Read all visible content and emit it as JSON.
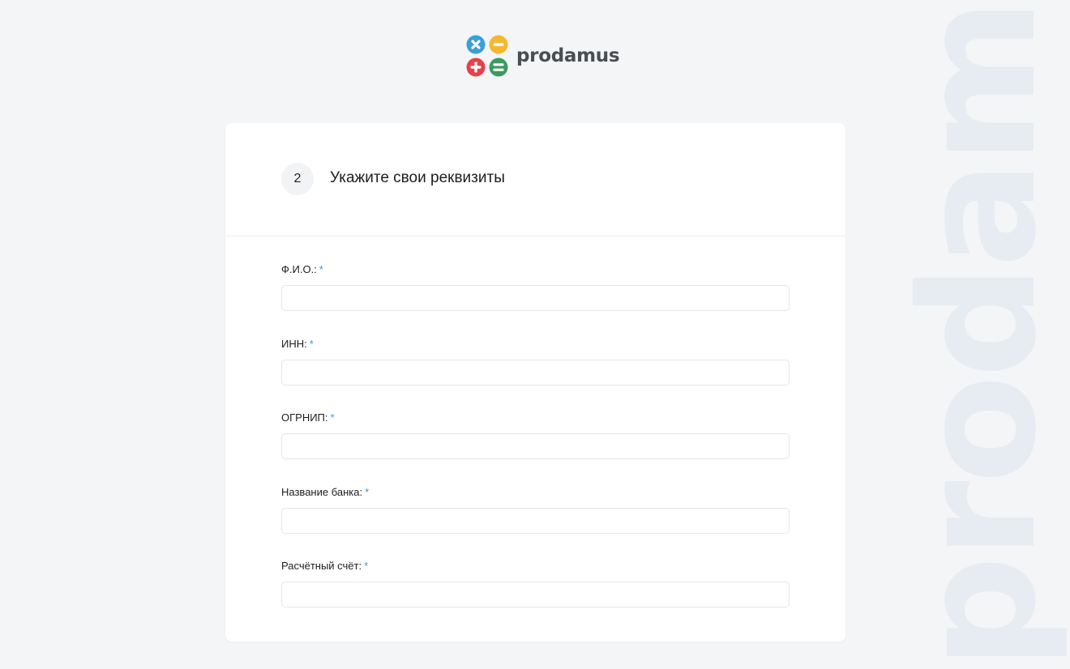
{
  "brand": {
    "name": "prodamus",
    "watermark": "prodamus",
    "colors": {
      "multiply": "#3b9fd8",
      "minus": "#f5b731",
      "plus": "#e5414b",
      "equals": "#3c9a62"
    }
  },
  "step": {
    "number": "2",
    "title": "Укажите свои реквизиты"
  },
  "form": {
    "required_mark": "*",
    "fields": [
      {
        "label": "Ф.И.О.:",
        "value": "",
        "placeholder": ""
      },
      {
        "label": "ИНН:",
        "value": "",
        "placeholder": ""
      },
      {
        "label": "ОГРНИП:",
        "value": "",
        "placeholder": ""
      },
      {
        "label": "Название банка:",
        "value": "",
        "placeholder": ""
      },
      {
        "label": "Расчётный счёт:",
        "value": "",
        "placeholder": ""
      }
    ]
  }
}
